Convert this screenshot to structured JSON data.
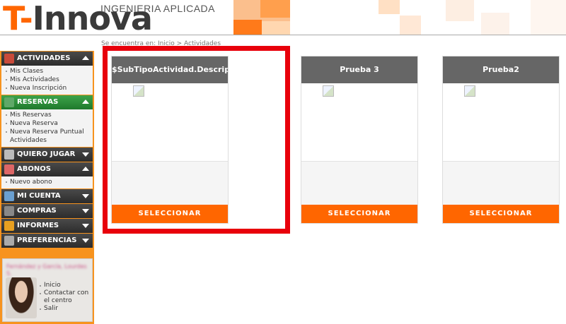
{
  "header": {
    "logo_text_t": "T-",
    "logo_text_rest": "Innova",
    "logo_subtitle": "INGENIERIA APLICADA",
    "brand_color": "#ff6600"
  },
  "breadcrumb": "Se encuentra en: Inicio > Actividades",
  "sidebar": {
    "sections": [
      {
        "label": "ACTIVIDADES",
        "icon": "calendar-icon",
        "expanded": true,
        "items": [
          "Mis Clases",
          "Mis Actividades",
          "Nueva Inscripción"
        ]
      },
      {
        "label": "RESERVAS",
        "icon": "reservations-icon",
        "expanded": true,
        "items": [
          "Mis Reservas",
          "Nueva Reserva",
          "Nueva Reserva Puntual Actividades"
        ]
      },
      {
        "label": "QUIERO JUGAR",
        "icon": "racket-icon",
        "expanded": false,
        "items": []
      },
      {
        "label": "ABONOS",
        "icon": "card-icon",
        "expanded": true,
        "items": [
          "Nuevo abono"
        ]
      },
      {
        "label": "MI CUENTA",
        "icon": "user-icon",
        "expanded": false,
        "items": []
      },
      {
        "label": "COMPRAS",
        "icon": "cart-icon",
        "expanded": false,
        "items": []
      },
      {
        "label": "INFORMES",
        "icon": "chart-icon",
        "expanded": false,
        "items": []
      },
      {
        "label": "PREFERENCIAS",
        "icon": "wrench-icon",
        "expanded": false,
        "items": []
      }
    ],
    "profile": {
      "name": "Fernández y García, Lourdes S.",
      "links": [
        "Inicio",
        "Contactar con el centro",
        "Salir"
      ]
    }
  },
  "cards": [
    {
      "title": "$SubTipoActividad.DescripcionBasica$",
      "button": "SELECCIONAR",
      "highlighted": true
    },
    {
      "title": "Prueba 3",
      "button": "SELECCIONAR",
      "highlighted": false
    },
    {
      "title": "Prueba2",
      "button": "SELECCIONAR",
      "highlighted": false
    }
  ]
}
